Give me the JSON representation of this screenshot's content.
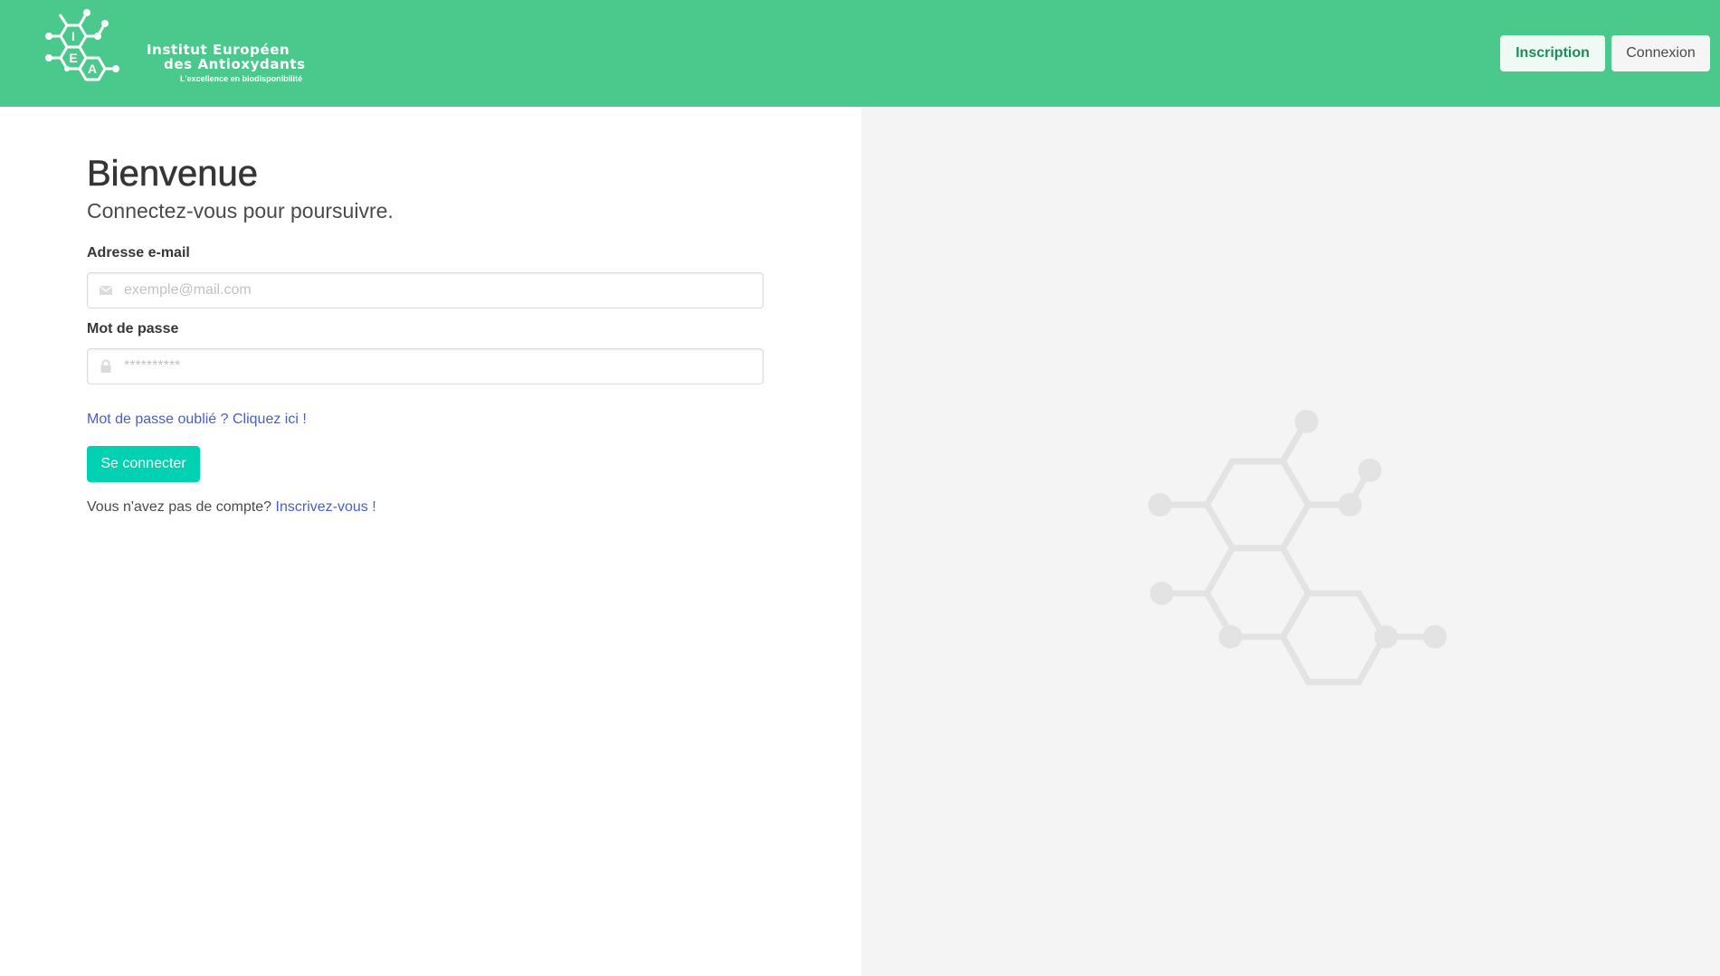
{
  "header": {
    "logo": {
      "letters": [
        "I",
        "E",
        "A"
      ],
      "title_line1": "Institut Européen",
      "title_line2": "des Antioxydants",
      "tagline": "L'excellence en biodisponibilité"
    },
    "inscription_label": "Inscription",
    "connexion_label": "Connexion",
    "colors": {
      "navbar": "#4bc98d",
      "primary": "#00d1b2",
      "link": "#485fc7"
    }
  },
  "login": {
    "title": "Bienvenue",
    "subtitle": "Connectez-vous pour poursuivre.",
    "email": {
      "label": "Adresse e-mail",
      "placeholder": "exemple@mail.com",
      "value": "",
      "icon": "envelope-icon"
    },
    "password": {
      "label": "Mot de passe",
      "placeholder": "**********",
      "value": "",
      "icon": "lock-icon"
    },
    "forgot_link": "Mot de passe oublié ? Cliquez ici !",
    "submit_label": "Se connecter",
    "no_account_text": "Vous n'avez pas de compte?",
    "signup_link": "Inscrivez-vous !"
  },
  "illustration": {
    "icon": "molecule-icon"
  }
}
